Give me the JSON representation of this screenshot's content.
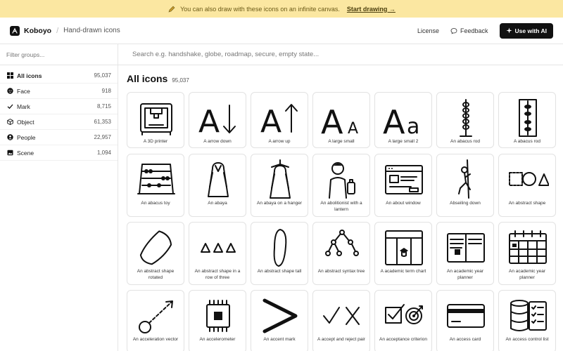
{
  "banner": {
    "text": "You can also draw with these icons on an infinite canvas.",
    "cta": "Start drawing →"
  },
  "header": {
    "brand": "Koboyo",
    "separator": "/",
    "subtitle": "Hand-drawn icons",
    "license": "License",
    "feedback": "Feedback",
    "ai_button": "Use with AI"
  },
  "sidebar": {
    "filter_placeholder": "Filter groups...",
    "items": [
      {
        "label": "All icons",
        "count": "95,037",
        "icon": "grid-icon"
      },
      {
        "label": "Face",
        "count": "918",
        "icon": "face-icon"
      },
      {
        "label": "Mark",
        "count": "8,715",
        "icon": "check-icon"
      },
      {
        "label": "Object",
        "count": "61,353",
        "icon": "cube-icon"
      },
      {
        "label": "People",
        "count": "22,957",
        "icon": "person-icon"
      },
      {
        "label": "Scene",
        "count": "1,094",
        "icon": "image-icon"
      }
    ]
  },
  "search": {
    "placeholder": "Search e.g. handshake, globe, roadmap, secure, empty state..."
  },
  "main": {
    "title": "All icons",
    "count": "95,037"
  },
  "icons": [
    "A 3D printer",
    "A arrow down",
    "A arrow up",
    "A large small",
    "A large small 2",
    "An abacus rod",
    "A abacus rod",
    "An abacus toy",
    "An abaya",
    "An abaya on a hanger",
    "An abolitionist with a lantern",
    "An about window",
    "Abseiling down",
    "An abstract shape",
    "An abstract shape rotated",
    "An abstract shape in a row of three",
    "An abstract shape tall",
    "An abstract syntax tree",
    "A academic term chart",
    "An academic year planner",
    "An academic year planner",
    "An acceleration vector",
    "An accelerometer",
    "An accent mark",
    "A accept and reject pair",
    "An acceptance criterion",
    "An access card",
    "An access control list"
  ],
  "colors": {
    "banner_bg": "#fbe7a1",
    "button_bg": "#111111",
    "border": "#e2e2e2"
  }
}
